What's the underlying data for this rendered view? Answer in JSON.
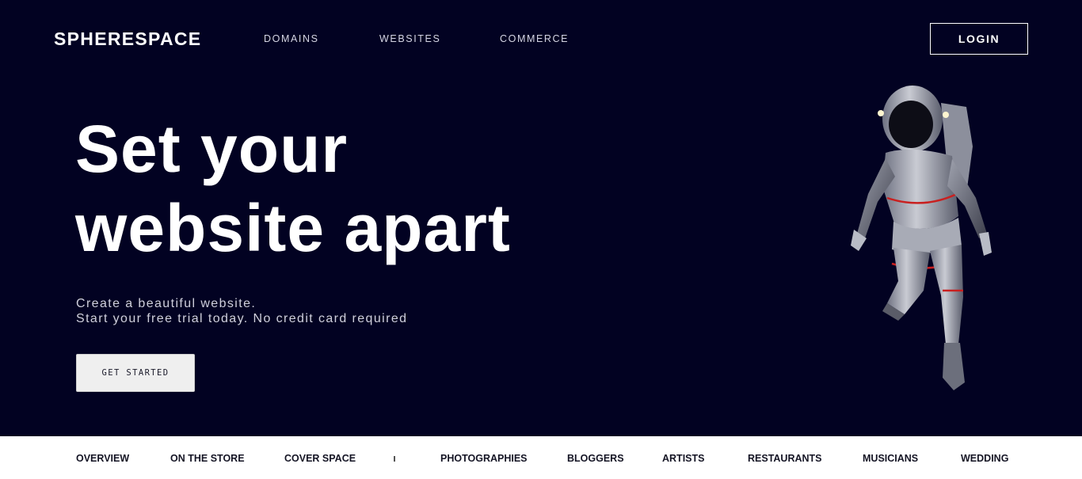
{
  "brand": "SPHERESPACE",
  "nav": {
    "items": [
      "DOMAINS",
      "WEBSITES",
      "COMMERCE"
    ],
    "login_label": "LOGIN"
  },
  "hero": {
    "headline_line1": "Set your",
    "headline_line2": "website apart",
    "sub_line1": "Create a beautiful website.",
    "sub_line2": "Start your free trial today. No credit card required",
    "cta_label": "GET STARTED",
    "image": "astronaut-illustration"
  },
  "subnav": {
    "items": [
      "OVERVIEW",
      "ON THE STORE",
      "COVER SPACE",
      "PHOTOGRAPHIES",
      "BLOGGERS",
      "ARTISTS",
      "RESTAURANTS",
      "MUSICIANS",
      "WEDDING"
    ]
  },
  "colors": {
    "background": "#020222",
    "text": "#ffffff",
    "cta_bg": "#efefef",
    "subnav_bg": "#ffffff"
  }
}
